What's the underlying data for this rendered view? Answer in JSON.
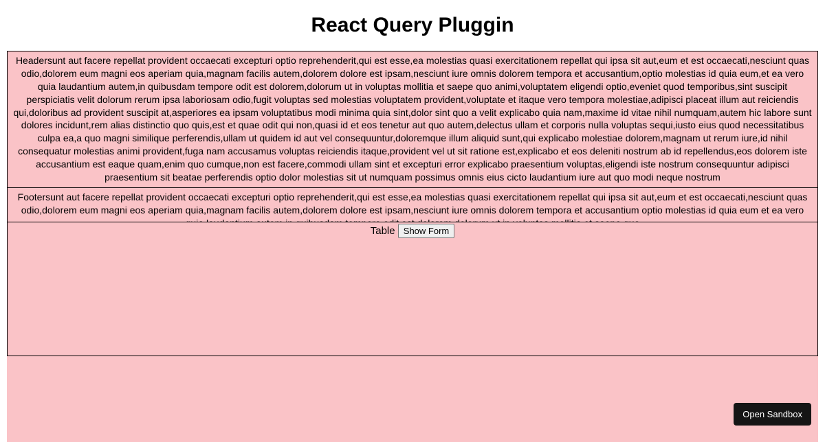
{
  "title": "React Query Pluggin",
  "headerText": "Headersunt aut facere repellat provident occaecati excepturi optio reprehenderit,qui est esse,ea molestias quasi exercitationem repellat qui ipsa sit aut,eum et est occaecati,nesciunt quas odio,dolorem eum magni eos aperiam quia,magnam facilis autem,dolorem dolore est ipsam,nesciunt iure omnis dolorem tempora et accusantium,optio molestias id quia eum,et ea vero quia laudantium autem,in quibusdam tempore odit est dolorem,dolorum ut in voluptas mollitia et saepe quo animi,voluptatem eligendi optio,eveniet quod temporibus,sint suscipit perspiciatis velit dolorum rerum ipsa laboriosam odio,fugit voluptas sed molestias voluptatem provident,voluptate et itaque vero tempora molestiae,adipisci placeat illum aut reiciendis qui,doloribus ad provident suscipit at,asperiores ea ipsam voluptatibus modi minima quia sint,dolor sint quo a velit explicabo quia nam,maxime id vitae nihil numquam,autem hic labore sunt dolores incidunt,rem alias distinctio quo quis,est et quae odit qui non,quasi id et eos tenetur aut quo autem,delectus ullam et corporis nulla voluptas sequi,iusto eius quod necessitatibus culpa ea,a quo magni similique perferendis,ullam ut quidem id aut vel consequuntur,doloremque illum aliquid sunt,qui explicabo molestiae dolorem,magnam ut rerum iure,id nihil consequatur molestias animi provident,fuga nam accusamus voluptas reiciendis itaque,provident vel ut sit ratione est,explicabo et eos deleniti nostrum ab id repellendus,eos dolorem iste accusantium est eaque quam,enim quo cumque,non est facere,commodi ullam sint et excepturi error explicabo praesentium voluptas,eligendi iste nostrum consequuntur adipisci praesentium sit beatae perferendis optio dolor molestias sit ut numquam possimus omnis eius cicto laudantium iure aut quo modi neque nostrum",
  "footerText": "Footersunt aut facere repellat provident occaecati excepturi optio reprehenderit,qui est esse,ea molestias quasi exercitationem repellat qui ipsa sit aut,eum et est occaecati,nesciunt quas odio,dolorem eum magni eos aperiam quia,magnam facilis autem,dolorem dolore est ipsam,nesciunt iure omnis dolorem tempora et accusantium optio molestias id quia eum et ea vero quia laudantium autem in quibusdam tempore odit est dolorem dolorum ut in voluptas mollitia et saepe quo",
  "tableLabel": "Table",
  "showFormButton": "Show Form",
  "openSandboxButton": "Open Sandbox"
}
